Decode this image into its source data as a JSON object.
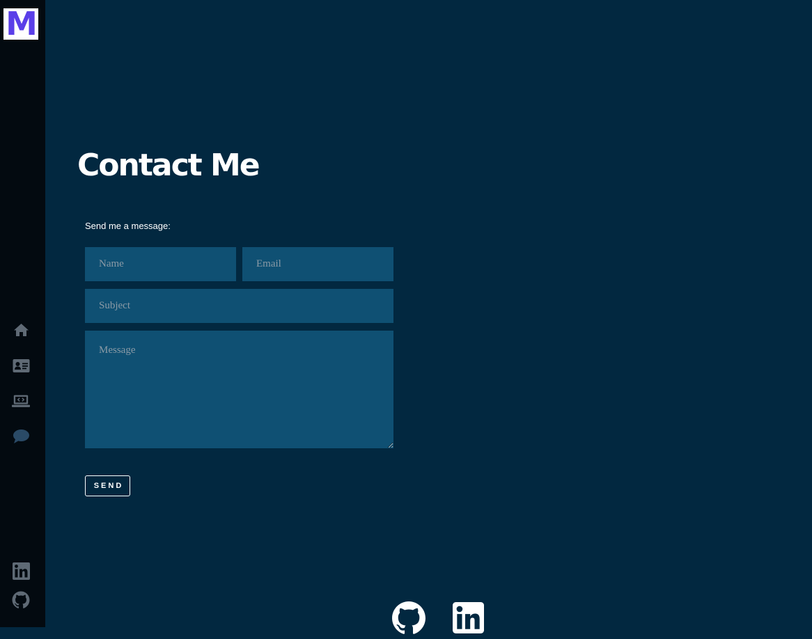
{
  "logo": {
    "letter": "M"
  },
  "sidebar": {
    "nav_items": [
      {
        "icon": "home-icon"
      },
      {
        "icon": "contact-card-icon"
      },
      {
        "icon": "laptop-code-icon"
      },
      {
        "icon": "chat-bubble-icon"
      }
    ],
    "social_items": [
      {
        "icon": "linkedin-icon"
      },
      {
        "icon": "github-icon"
      }
    ]
  },
  "main": {
    "title": "Contact Me",
    "form": {
      "caption": "Send me a message:",
      "name_placeholder": "Name",
      "email_placeholder": "Email",
      "subject_placeholder": "Subject",
      "message_placeholder": "Message",
      "send_label": "SEND"
    },
    "footer": {
      "icons": [
        "github-icon",
        "linkedin-icon"
      ]
    }
  },
  "colors": {
    "page_background": "#022840",
    "sidebar_background": "#030a10",
    "field_background": "#0f5073",
    "logo_accent": "#5a3ee8",
    "sidebar_icon": "#5f6a75",
    "active_icon": "#2a4a66"
  }
}
